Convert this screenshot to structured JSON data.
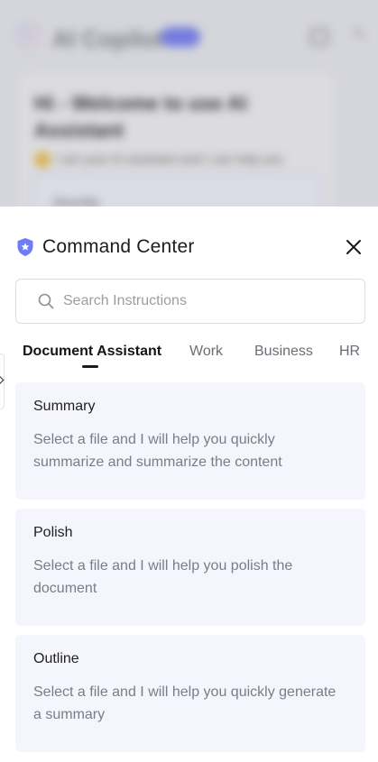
{
  "background": {
    "app_title": "AI Copilot",
    "heading": "Hi - Welcome to use AI Assistant",
    "subtitle": "I am your AI assistant and I can help you",
    "input_hint": "Describe"
  },
  "panel": {
    "title": "Command Center",
    "search_placeholder": "Search Instructions",
    "tabs": [
      {
        "label": "Document Assistant",
        "active": true
      },
      {
        "label": "Work",
        "active": false
      },
      {
        "label": "Business",
        "active": false
      },
      {
        "label": "HR",
        "active": false
      }
    ],
    "cards": [
      {
        "title": "Summary",
        "description": "Select a file and I will help you quickly summarize and summarize the content"
      },
      {
        "title": "Polish",
        "description": "Select a file and I will help you polish the document"
      },
      {
        "title": "Outline",
        "description": "Select a file and I will help you quickly generate a summary"
      }
    ]
  },
  "colors": {
    "accent": "#6f7bf7",
    "card_background": "#f5f6fd"
  },
  "icons": {
    "header": "shield-star-icon",
    "close": "close-icon",
    "search": "search-icon",
    "side_handle": "chevron-right-icon"
  }
}
